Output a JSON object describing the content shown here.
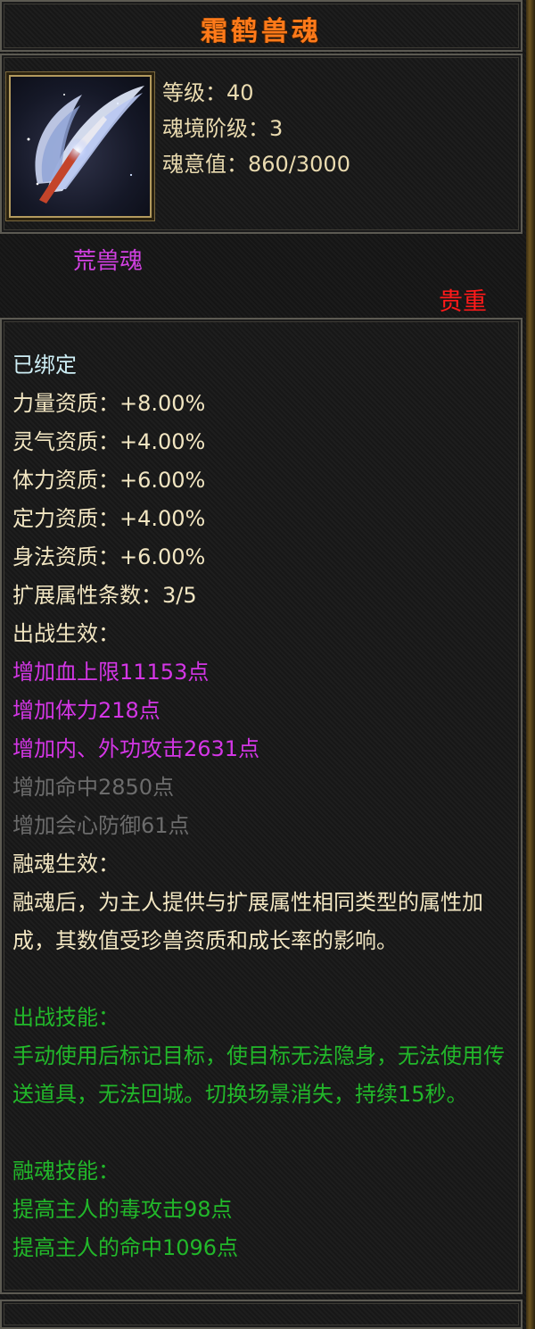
{
  "title": "霜鹤兽魂",
  "icon": {
    "name": "frost-crane-wing-icon",
    "colors": {
      "feather": "#dfe8ff",
      "blade": "#c4442a",
      "bg": "#151827"
    }
  },
  "info": {
    "level": "等级：40",
    "stage": "魂境阶级：3",
    "soul_value": "魂意值：860/3000"
  },
  "type_label": "荒兽魂",
  "rarity": "贵重",
  "details": {
    "bound": "已绑定",
    "attrs": [
      "力量资质：+8.00%",
      "灵气资质：+4.00%",
      "体力资质：+6.00%",
      "定力资质：+4.00%",
      "身法资质：+6.00%"
    ],
    "ext_count": "扩展属性条数：3/5",
    "battle_header": "出战生效：",
    "battle_active": [
      "增加血上限11153点",
      "增加体力218点",
      "增加内、外功攻击2631点"
    ],
    "battle_inactive": [
      "增加命中2850点",
      "增加会心防御61点"
    ],
    "fusion_header": "融魂生效：",
    "fusion_desc": "融魂后，为主人提供与扩展属性相同类型的属性加成，其数值受珍兽资质和成长率的影响。",
    "skill_header": "出战技能：",
    "skill_desc": "手动使用后标记目标，使目标无法隐身，无法使用传送道具，无法回城。切换场景消失，持续15秒。",
    "fusion_skill_header": "融魂技能：",
    "fusion_skills": [
      "提高主人的毒攻击98点",
      "提高主人的命中1096点"
    ]
  },
  "colors": {
    "title": "#ff7a1a",
    "info": "#eadbb0",
    "type": "#d040e0",
    "rarity": "#ff1a1a",
    "bound": "#cdeef5",
    "text": "#f2e6c2",
    "active": "#d436e6",
    "inactive": "#6c6c6c",
    "skill": "#22b82a"
  }
}
